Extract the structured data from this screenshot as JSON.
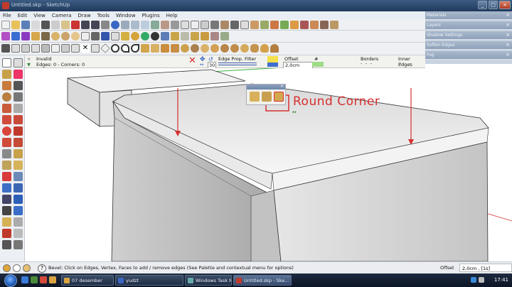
{
  "window": {
    "title": "Untitled.skp - SketchUp"
  },
  "menu": [
    "File",
    "Edit",
    "View",
    "Camera",
    "Draw",
    "Tools",
    "Window",
    "Plugins",
    "Help"
  ],
  "right_panel": {
    "items": [
      "Materials",
      "Layers",
      "Shadow Settings",
      "Soften Edges",
      "Fog"
    ]
  },
  "edge_tool": {
    "status": "Invalid",
    "counts": "Edges: 0 - Corners: 0",
    "segments_value": "30",
    "filter_label": "Edge Prop. Filter",
    "offset_label": "Offset",
    "offset_value": "2,0cm",
    "hash_label": "#",
    "borders_label": "Borders",
    "inner_edges_label": "Inner Edges",
    "dash_placeholder": "- - -"
  },
  "palette": {
    "title": "Round Corner"
  },
  "annotation": {
    "text": "Round Corner"
  },
  "status_bar": {
    "help_glyph": "?",
    "message": "Bevel: Click on Edges, Vertex, Faces to add / remove edges (See Palette and contextual menu for options)",
    "offset_label": "Offset",
    "offset_value": "2,0cm , [1s]"
  },
  "taskbar": {
    "tasks": [
      {
        "label": "07 desember",
        "active": false
      },
      {
        "label": "yudzt",
        "active": false
      },
      {
        "label": "Windows Task Ma...",
        "active": false
      },
      {
        "label": "Untitled.skp - Ske...",
        "active": true
      }
    ],
    "clock": "17:41"
  },
  "colors": {
    "accent_red": "#d63030",
    "offset_swatch": "#f4e04a"
  }
}
